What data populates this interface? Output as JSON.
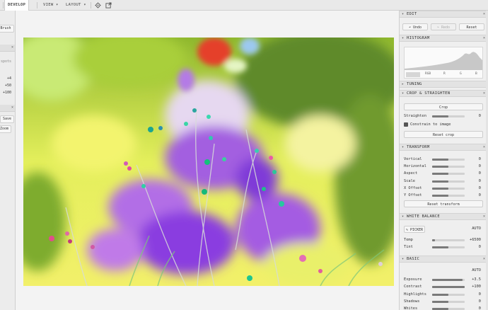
{
  "topbar": {
    "tabs": [
      {
        "label": "DEVELOP",
        "active": true
      },
      {
        "label": "VIEW ▾"
      },
      {
        "label": "LAYOUT ▾"
      }
    ]
  },
  "left_panel": {
    "brush_label": "Brush",
    "spots_label": "spots",
    "values": [
      "+4",
      "+50",
      "+100"
    ],
    "save_label": "Save",
    "zoom_label": "Zoom"
  },
  "right_panel": {
    "edit": {
      "title": "EDIT",
      "undo": "↶ Undo",
      "redo": "↷ Redo",
      "reset": "Reset"
    },
    "histogram": {
      "title": "HISTOGRAM",
      "labels": [
        "RGB",
        "R",
        "G",
        "B"
      ]
    },
    "tuning": {
      "title": "TUNING"
    },
    "crop": {
      "title": "CROP & STRAIGHTEN",
      "crop_btn": "Crop",
      "straighten_label": "Straighten",
      "straighten_value": "0",
      "constrain_label": "Constrain to image",
      "reset_crop": "Reset crop"
    },
    "transform": {
      "title": "TRANSFORM",
      "rows": [
        {
          "label": "Vertical",
          "value": "0",
          "fill": 0.5
        },
        {
          "label": "Horizontal",
          "value": "0",
          "fill": 0.5
        },
        {
          "label": "Aspect",
          "value": "0",
          "fill": 0.5
        },
        {
          "label": "Scale",
          "value": "0",
          "fill": 0.5
        },
        {
          "label": "X Offset",
          "value": "0",
          "fill": 0.5
        },
        {
          "label": "Y Offset",
          "value": "0",
          "fill": 0.5
        }
      ],
      "reset": "Reset transform"
    },
    "white_balance": {
      "title": "WHITE BALANCE",
      "picker": "PICKER",
      "auto": "AUTO",
      "rows": [
        {
          "label": "Temp",
          "value": "+6500",
          "fill": 0.08
        },
        {
          "label": "Tint",
          "value": "0",
          "fill": 0.5
        }
      ]
    },
    "basic": {
      "title": "BASIC",
      "auto": "AUTO",
      "rows": [
        {
          "label": "Exposure",
          "value": "+3.5",
          "fill": 0.93
        },
        {
          "label": "Contrast",
          "value": "+100",
          "fill": 1.0
        },
        {
          "label": "Highlights",
          "value": "0",
          "fill": 0.5
        },
        {
          "label": "Shadows",
          "value": "0",
          "fill": 0.5
        },
        {
          "label": "Whites",
          "value": "0",
          "fill": 0.5
        }
      ]
    }
  },
  "colors": {
    "accent": "#7a7a7a",
    "panel": "#efefef"
  }
}
